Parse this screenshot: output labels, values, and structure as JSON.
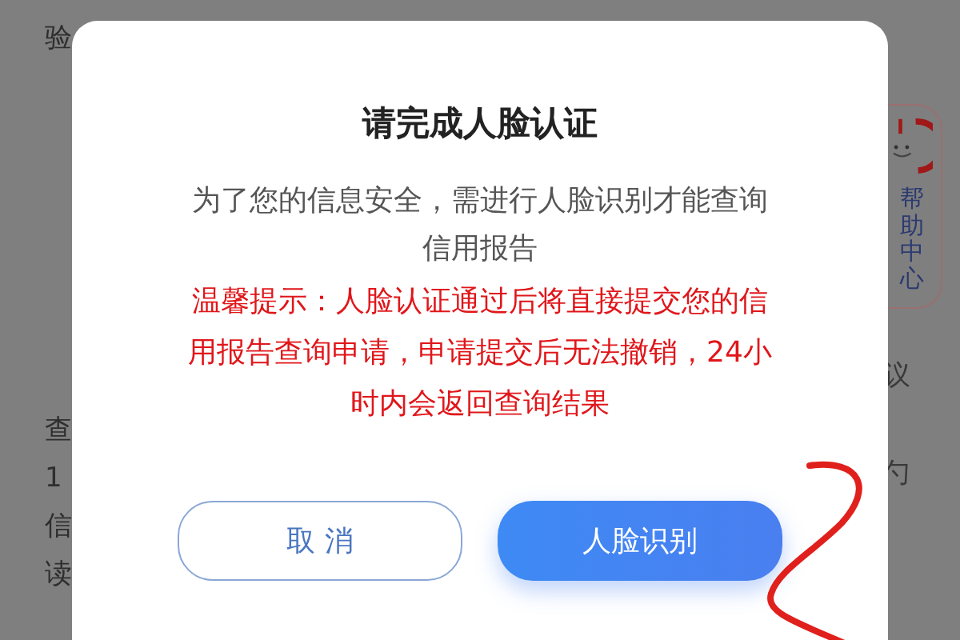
{
  "background": {
    "left_texts": [
      "验",
      "查",
      "1",
      "信",
      "读"
    ],
    "right_texts": [
      "议",
      "勺"
    ],
    "help_center": {
      "label": "帮助中心"
    }
  },
  "dialog": {
    "title": "请完成人脸认证",
    "message": "为了您的信息安全，需进行人脸识别才能查询信用报告",
    "tip": "温馨提示：人脸认证通过后将直接提交您的信用报告查询申请，申请提交后无法撤销，24小时内会返回查询结果",
    "buttons": [
      {
        "label": "取 消",
        "kind": "secondary"
      },
      {
        "label": "人脸识别",
        "kind": "primary"
      }
    ]
  }
}
